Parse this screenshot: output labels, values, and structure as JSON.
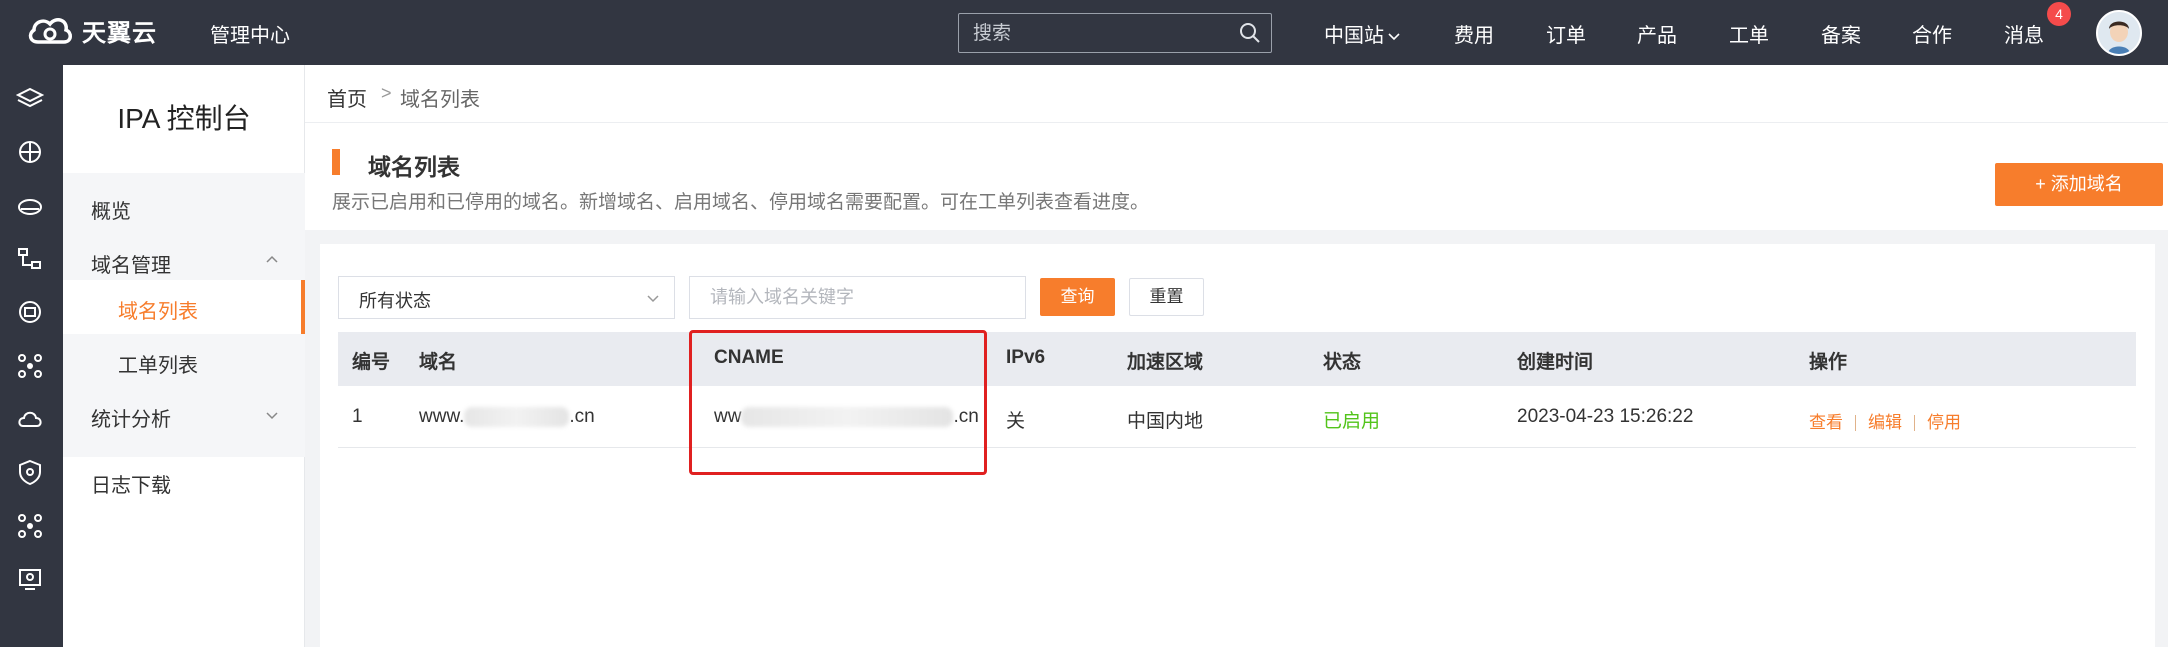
{
  "topbar": {
    "logo_text": "天翼云",
    "console_label": "管理中心",
    "search_placeholder": "搜索",
    "nav": [
      "中国站",
      "费用",
      "订单",
      "产品",
      "工单",
      "备案",
      "合作",
      "消息"
    ],
    "message_badge": "4"
  },
  "sidebar": {
    "title": "IPA 控制台",
    "items": {
      "overview": "概览",
      "domain_mgmt": "域名管理",
      "domain_list": "域名列表",
      "ticket_list": "工单列表",
      "stats": "统计分析",
      "log_download": "日志下载"
    }
  },
  "breadcrumb": {
    "home": "首页",
    "separator": ">",
    "current": "域名列表"
  },
  "header": {
    "title": "域名列表",
    "description": "展示已启用和已停用的域名。新增域名、启用域名、停用域名需要配置。可在工单列表查看进度。",
    "add_button": "+ 添加域名"
  },
  "filters": {
    "status_select_value": "所有状态",
    "domain_placeholder": "请输入域名关键字",
    "query_button": "查询",
    "reset_button": "重置"
  },
  "table": {
    "columns": [
      "编号",
      "域名",
      "CNAME",
      "IPv6",
      "加速区域",
      "状态",
      "创建时间",
      "操作"
    ],
    "rows": [
      {
        "id": "1",
        "domain_prefix": "www.",
        "domain_suffix": ".cn",
        "cname_prefix": "ww",
        "cname_suffix": ".cn",
        "ipv6": "关",
        "region": "中国内地",
        "status": "已启用",
        "created": "2023-04-23 15:26:22",
        "actions": [
          "查看",
          "编辑",
          "停用"
        ]
      }
    ]
  },
  "colors": {
    "accent": "#f77d2c",
    "topbar": "#323641",
    "status_enabled": "#52c41a",
    "highlight": "#e02020"
  }
}
